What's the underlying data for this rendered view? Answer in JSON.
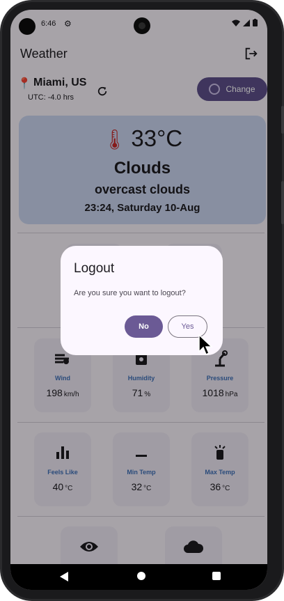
{
  "status": {
    "time": "6:46"
  },
  "app": {
    "title": "Weather"
  },
  "location": {
    "city": "Miami, US",
    "utc": "UTC: -4.0 hrs",
    "change_label": "Change"
  },
  "current": {
    "temperature": "33°C",
    "condition": "Clouds",
    "description": "overcast clouds",
    "datetime": "23:24, Saturday 10-Aug"
  },
  "metrics": [
    {
      "label": "Wind",
      "value": "198",
      "unit": "km/h",
      "icon": "wind-icon"
    },
    {
      "label": "Humidity",
      "value": "71",
      "unit": "%",
      "icon": "humidity-icon"
    },
    {
      "label": "Pressure",
      "value": "1018",
      "unit": "hPa",
      "icon": "pressure-icon"
    },
    {
      "label": "Feels Like",
      "value": "40",
      "unit": "°C",
      "icon": "bar-chart-icon"
    },
    {
      "label": "Min Temp",
      "value": "32",
      "unit": "°C",
      "icon": "min-temp-icon"
    },
    {
      "label": "Max Temp",
      "value": "36",
      "unit": "°C",
      "icon": "max-temp-icon"
    }
  ],
  "bottom_tiles": [
    {
      "icon": "eye-icon"
    },
    {
      "icon": "cloud-icon"
    }
  ],
  "dialog": {
    "title": "Logout",
    "message": "Are you sure you want to logout?",
    "no_label": "No",
    "yes_label": "Yes"
  },
  "colors": {
    "primary": "#5d4e8a",
    "card": "#c9d3ed",
    "label": "#3f6fb5"
  }
}
